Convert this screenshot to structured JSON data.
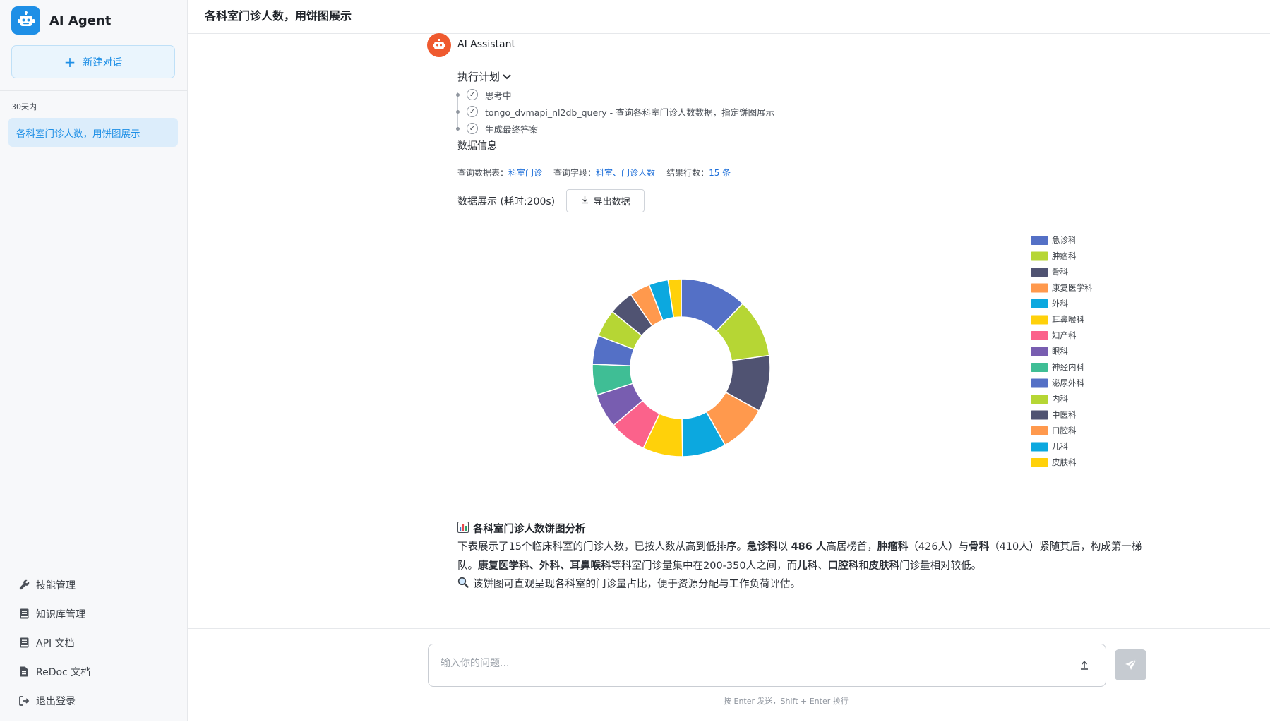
{
  "app": {
    "title": "AI Agent",
    "new_chat_label": "新建对话"
  },
  "sidebar": {
    "group_label": "30天内",
    "conversations": [
      {
        "title": "各科室门诊人数，用饼图展示"
      }
    ],
    "menu": [
      {
        "label": "技能管理",
        "icon": "wrench-icon"
      },
      {
        "label": "知识库管理",
        "icon": "book-icon"
      },
      {
        "label": "API 文档",
        "icon": "book-icon"
      },
      {
        "label": "ReDoc 文档",
        "icon": "document-icon"
      },
      {
        "label": "退出登录",
        "icon": "logout-icon"
      }
    ]
  },
  "header": {
    "title": "各科室门诊人数，用饼图展示"
  },
  "message": {
    "sender": "AI Assistant",
    "plan": {
      "title": "执行计划",
      "steps": [
        {
          "label": "思考中"
        },
        {
          "label": "tongo_dvmapi_nl2db_query - 查询各科室门诊人数数据，指定饼图展示"
        },
        {
          "label": "生成最终答案"
        }
      ]
    },
    "data_info": {
      "title": "数据信息",
      "table_key": "查询数据表：",
      "table_value": "科室门诊",
      "fields_key": "查询字段：",
      "fields_value": "科室、门诊人数",
      "rows_key": "结果行数：",
      "rows_value": "15 条"
    },
    "display": {
      "label": "数据展示 (耗时:200s)",
      "export_label": "导出数据"
    },
    "analysis": {
      "title": "各科室门诊人数饼图分析",
      "p1": "下表展示了15个临床科室的门诊人数，已按人数从高到低排序。",
      "p1_b1": "急诊科",
      "p1_t2": "以 ",
      "p1_b2": "486 人",
      "p1_t3": "高居榜首，",
      "p1_b3": "肿瘤科",
      "p1_t4": "（426人）与",
      "p1_b4": "骨科",
      "p1_t5": "（410人）紧随其后，构成第一梯队。",
      "p1_b5": "康复医学科、外科、耳鼻喉科",
      "p1_t6": "等科室门诊量集中在200-350人之间，而",
      "p1_b6": "儿科",
      "p1_t7": "、",
      "p1_b7": "口腔科",
      "p1_t8": "和",
      "p1_b8": "皮肤科",
      "p1_t9": "门诊量相对较低。",
      "note": "该饼图可直观呈现各科室的门诊量占比，便于资源分配与工作负荷评估。"
    }
  },
  "input": {
    "placeholder": "输入你的问题...",
    "hint": "按 Enter 发送，Shift + Enter 换行"
  },
  "colors": {
    "accent": "#1e8fe6",
    "avatar": "#ef5a2f"
  },
  "chart_data": {
    "type": "pie",
    "donut": true,
    "legend_position": "right",
    "categories": [
      "急诊科",
      "肿瘤科",
      "骨科",
      "康复医学科",
      "外科",
      "耳鼻喉科",
      "妇产科",
      "眼科",
      "神经内科",
      "泌尿外科",
      "内科",
      "中医科",
      "口腔科",
      "儿科",
      "皮肤科"
    ],
    "values": [
      486,
      426,
      410,
      350,
      320,
      290,
      270,
      250,
      225,
      210,
      200,
      180,
      150,
      140,
      95
    ],
    "colors": [
      "#5470c6",
      "#b6d634",
      "#505372",
      "#ff994d",
      "#0ca8df",
      "#ffd10a",
      "#fb628b",
      "#785db0",
      "#3fbe95",
      "#5470c6",
      "#b6d634",
      "#505372",
      "#ff994d",
      "#0ca8df",
      "#ffd10a"
    ]
  }
}
